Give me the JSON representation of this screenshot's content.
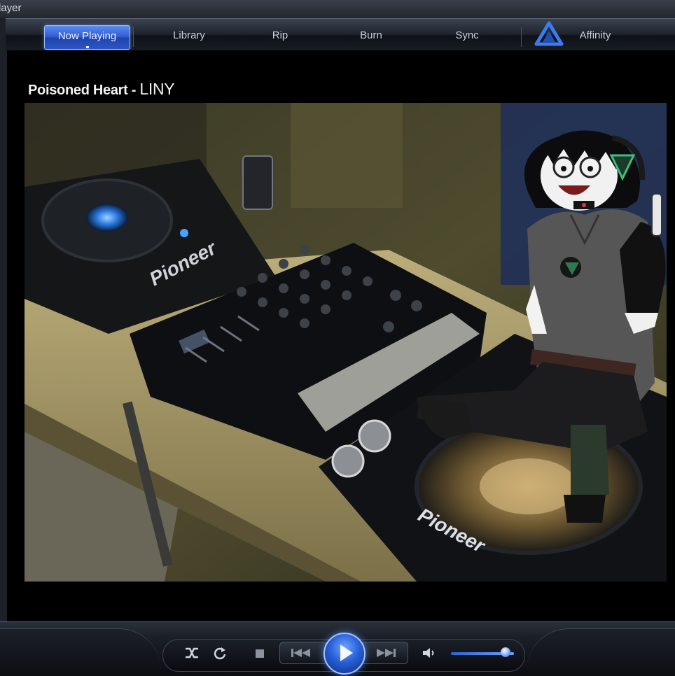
{
  "window": {
    "title": "layer"
  },
  "nav": {
    "tabs": [
      {
        "label": "Now Playing",
        "active": true
      },
      {
        "label": "Library",
        "active": false
      },
      {
        "label": "Rip",
        "active": false
      },
      {
        "label": "Burn",
        "active": false
      },
      {
        "label": "Sync",
        "active": false
      },
      {
        "label": "Affinity",
        "active": false
      }
    ],
    "affinity_icon": "triangle-a-icon"
  },
  "now_playing": {
    "song": "Poisoned Heart",
    "separator": " - ",
    "artist": "LINY"
  },
  "video": {
    "brand_text": "Pioneer",
    "brand_text_2": "Pioneer"
  },
  "controls": {
    "shuffle_icon": "shuffle-icon",
    "repeat_icon": "repeat-icon",
    "stop_icon": "stop-icon",
    "prev_icon": "previous-icon",
    "play_icon": "play-icon",
    "next_icon": "next-icon",
    "mute_icon": "speaker-icon",
    "volume_level": 0.87
  },
  "colors": {
    "accent": "#2f5bd0",
    "background": "#050608"
  }
}
